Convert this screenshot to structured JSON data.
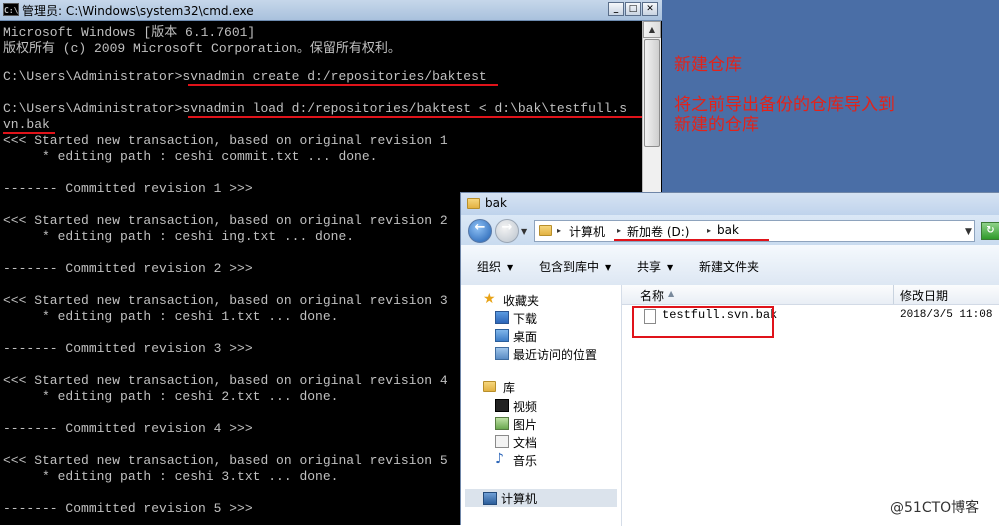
{
  "cmd": {
    "title": "管理员: C:\\Windows\\system32\\cmd.exe",
    "icon_label": "C:\\",
    "lines": [
      "Microsoft Windows [版本 6.1.7601]",
      "版权所有 (c) 2009 Microsoft Corporation。保留所有权利。",
      "",
      "C:\\Users\\Administrator>svnadmin create d:/repositories/baktest",
      "",
      "C:\\Users\\Administrator>svnadmin load d:/repositories/baktest < d:\\bak\\testfull.s",
      "vn.bak",
      "<<< Started new transaction, based on original revision 1",
      "     * editing path : ceshi commit.txt ... done.",
      "",
      "------- Committed revision 1 >>>",
      "",
      "<<< Started new transaction, based on original revision 2",
      "     * editing path : ceshi ing.txt ... done.",
      "",
      "------- Committed revision 2 >>>",
      "",
      "<<< Started new transaction, based on original revision 3",
      "     * editing path : ceshi 1.txt ... done.",
      "",
      "------- Committed revision 3 >>>",
      "",
      "<<< Started new transaction, based on original revision 4",
      "     * editing path : ceshi 2.txt ... done.",
      "",
      "------- Committed revision 4 >>>",
      "",
      "<<< Started new transaction, based on original revision 5",
      "     * editing path : ceshi 3.txt ... done.",
      "",
      "------- Committed revision 5 >>>"
    ]
  },
  "annotations": {
    "note1": "新建仓库",
    "note2_line1": "将之前导出备份的仓库导入到",
    "note2_line2": "新建的仓库",
    "accent": "#e2231a"
  },
  "explorer": {
    "title": "bak",
    "breadcrumb": [
      "计算机",
      "新加卷 (D:)",
      "bak"
    ],
    "toolbar": {
      "organize": "组织",
      "include": "包含到库中",
      "share": "共享",
      "new_folder": "新建文件夹"
    },
    "nav": {
      "favorites": "收藏夹",
      "downloads": "下载",
      "desktop": "桌面",
      "recent": "最近访问的位置",
      "libraries": "库",
      "videos": "视频",
      "pictures": "图片",
      "documents": "文档",
      "music": "音乐",
      "computer": "计算机"
    },
    "columns": {
      "name": "名称",
      "modified": "修改日期"
    },
    "files": [
      {
        "name": "testfull.svn.bak",
        "modified": "2018/3/5 11:08"
      }
    ]
  },
  "watermark": "@51CTO博客"
}
